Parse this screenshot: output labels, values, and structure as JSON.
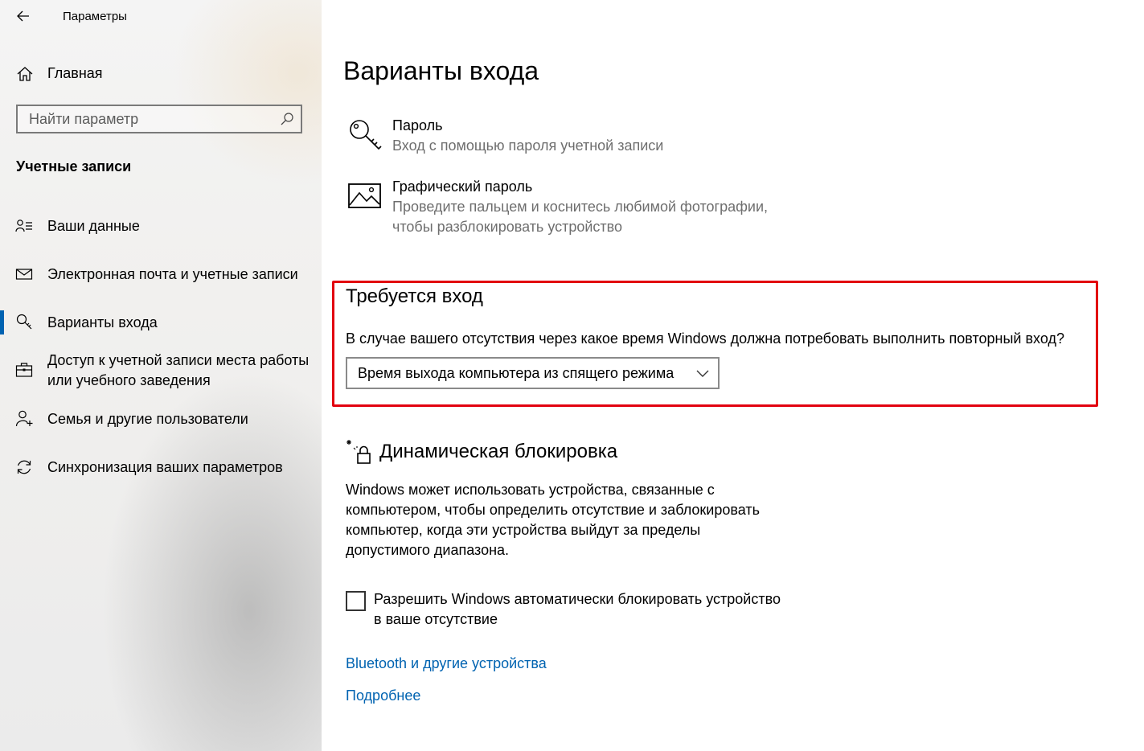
{
  "window": {
    "title": "Параметры",
    "back_icon": "arrow-left-icon"
  },
  "sidebar": {
    "home_label": "Главная",
    "search_placeholder": "Найти параметр",
    "section_title": "Учетные записи",
    "items": [
      {
        "label": "Ваши данные",
        "icon": "person-card-icon",
        "active": false
      },
      {
        "label": "Электронная почта и учетные записи",
        "icon": "mail-icon",
        "active": false
      },
      {
        "label": "Варианты входа",
        "icon": "key-icon",
        "active": true
      },
      {
        "label": "Доступ к учетной записи места работы или учебного заведения",
        "line1": "Доступ к учетной записи места работы",
        "line2": "или учебного заведения",
        "icon": "briefcase-icon",
        "active": false
      },
      {
        "label": "Семья и другие пользователи",
        "icon": "person-add-icon",
        "active": false
      },
      {
        "label": "Синхронизация ваших параметров",
        "icon": "sync-icon",
        "active": false
      }
    ],
    "accent_color": "#0063b1"
  },
  "main": {
    "title": "Варианты входа",
    "options": [
      {
        "title": "Пароль",
        "desc1": "Вход с помощью пароля учетной записи",
        "icon": "key-icon"
      },
      {
        "title": "Графический пароль",
        "desc1": "Проведите пальцем и коснитесь любимой фотографии,",
        "desc2": "чтобы разблокировать устройство",
        "icon": "picture-icon"
      }
    ],
    "require_signin": {
      "heading": "Требуется вход",
      "question": "В случае вашего отсутствия через какое время Windows должна потребовать выполнить повторный вход?",
      "dropdown_value": "Время выхода компьютера из спящего режима",
      "highlight_color": "#e2000f"
    },
    "dynamic_lock": {
      "heading": "Динамическая блокировка",
      "desc_lines": [
        "Windows может использовать устройства, связанные с",
        "компьютером, чтобы определить отсутствие и заблокировать",
        "компьютер, когда эти устройства выйдут за пределы",
        "допустимого диапазона."
      ],
      "checkbox_line1": "Разрешить Windows автоматически блокировать устройство",
      "checkbox_line2": "в ваше отсутствие",
      "checkbox_checked": false
    },
    "links": {
      "bluetooth": "Bluetooth и другие устройства",
      "more": "Подробнее"
    },
    "link_color": "#0063b1"
  }
}
